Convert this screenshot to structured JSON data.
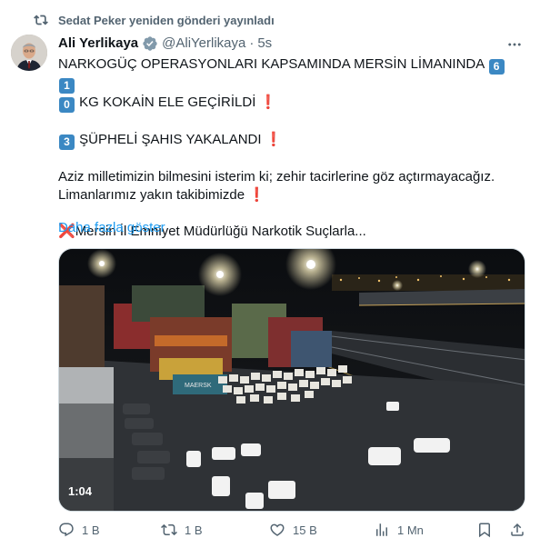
{
  "repost": {
    "text": "Sedat Peker yeniden gönderi yayınladı",
    "icon": "repost-icon"
  },
  "author": {
    "name": "Ali Yerlikaya",
    "handle": "@AliYerlikaya",
    "time": "5s",
    "verified": true
  },
  "tweet": {
    "line1_text": "NARKOGÜÇ OPERASYONLARI KAPSAMINDA MERSİN LİMANINDA",
    "line1_digit1": "6",
    "line1_digit2": "1",
    "line2_digit": "0",
    "line2_text": "KG KOKAİN ELE GEÇİRİLDİ",
    "line3_digit": "3",
    "line3_text": "ŞÜPHELİ ŞAHIS YAKALANDI",
    "line4_text": "Aziz milletimizin bilmesini isterim ki; zehir tacirlerine göz açtırmayacağız.",
    "line5_text": "Limanlarımız yakın takibimizde",
    "line6_text": "Mersin İl Emniyet Müdürlüğü Narkotik Suçlarla...",
    "exclamation": "❗",
    "cross": "❌"
  },
  "show_more": "Daha fazla göster",
  "media": {
    "duration": "1:04",
    "container_label": "MAERSK"
  },
  "actions": {
    "replies": "1 B",
    "reposts": "1 B",
    "likes": "15 B",
    "views": "1 Mn"
  },
  "colors": {
    "accent": "#1d9bf0",
    "muted": "#536471",
    "keycap": "#3b88c3",
    "alert": "#dd2e44"
  }
}
